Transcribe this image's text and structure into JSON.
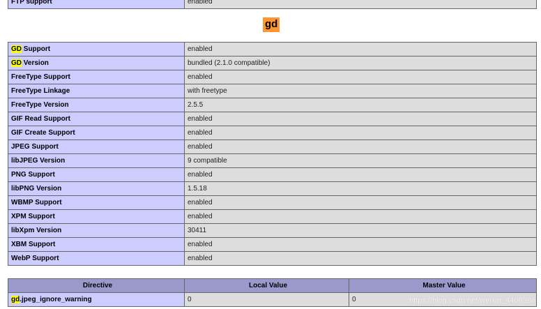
{
  "ftp": {
    "label": "FTP support",
    "value": "enabled"
  },
  "section": {
    "title": "gd"
  },
  "rows": [
    {
      "prefix": "GD",
      "label": " Support",
      "value": "enabled"
    },
    {
      "prefix": "GD",
      "label": " Version",
      "value": "bundled (2.1.0 compatible)"
    },
    {
      "prefix": "",
      "label": "FreeType Support",
      "value": "enabled"
    },
    {
      "prefix": "",
      "label": "FreeType Linkage",
      "value": "with freetype"
    },
    {
      "prefix": "",
      "label": "FreeType Version",
      "value": "2.5.5"
    },
    {
      "prefix": "",
      "label": "GIF Read Support",
      "value": "enabled"
    },
    {
      "prefix": "",
      "label": "GIF Create Support",
      "value": "enabled"
    },
    {
      "prefix": "",
      "label": "JPEG Support",
      "value": "enabled"
    },
    {
      "prefix": "",
      "label": "libJPEG Version",
      "value": "9 compatible"
    },
    {
      "prefix": "",
      "label": "PNG Support",
      "value": "enabled"
    },
    {
      "prefix": "",
      "label": "libPNG Version",
      "value": "1.5.18"
    },
    {
      "prefix": "",
      "label": "WBMP Support",
      "value": "enabled"
    },
    {
      "prefix": "",
      "label": "XPM Support",
      "value": "enabled"
    },
    {
      "prefix": "",
      "label": "libXpm Version",
      "value": "30411"
    },
    {
      "prefix": "",
      "label": "XBM Support",
      "value": "enabled"
    },
    {
      "prefix": "",
      "label": "WebP Support",
      "value": "enabled"
    }
  ],
  "directives": {
    "headers": [
      "Directive",
      "Local Value",
      "Master Value"
    ],
    "rows": [
      {
        "prefix": "gd",
        "name": ".jpeg_ignore_warning",
        "local": "0",
        "master": "0"
      }
    ]
  },
  "watermark": "https://blog.csdn.net/weixin_4408986",
  "colors": {
    "label_cell": "#ccccff",
    "value_cell": "#dddddd",
    "header_cell": "#9999cc",
    "search_highlight": "#f9ff00",
    "section_highlight": "#ff9632"
  }
}
